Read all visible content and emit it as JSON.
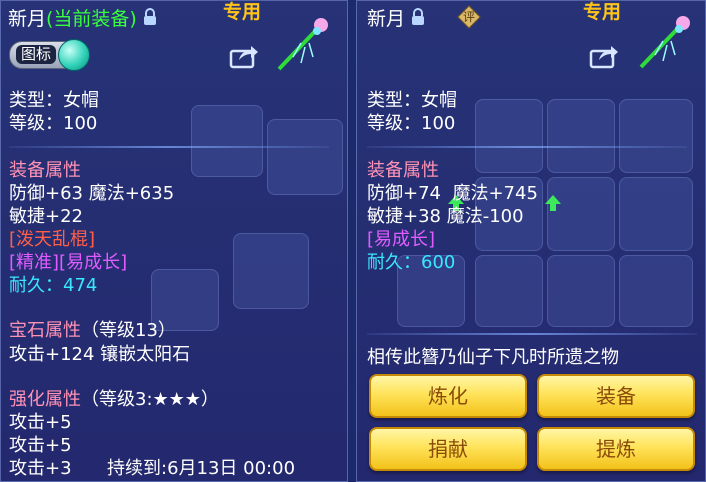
{
  "left": {
    "title_name": "新月",
    "title_equipped": "(当前装备)",
    "exclusive": "专用",
    "toggle_label": "图标",
    "type_line": "类型：女帽",
    "level_line": "等级：100",
    "attr_title": "装备属性",
    "attr_line1": "防御+63 魔法+635",
    "attr_line2": "敏捷+22",
    "special1": "[泼天乱棍]",
    "special2": "[精准][易成长]",
    "durability_label": "耐久：",
    "durability_value": "474",
    "gem_title": "宝石属性",
    "gem_level": "（等级13）",
    "gem_line": "攻击+124 镶嵌太阳石",
    "enhance_title": "强化属性",
    "enhance_level": "（等级3:★★★）",
    "enhance_line1": "攻击+5",
    "enhance_line2": "攻击+5",
    "enhance_line3": "攻击+3",
    "enhance_duration": "持续到:6月13日 00:00"
  },
  "right": {
    "title_name": "新月",
    "appraise_badge": "评",
    "exclusive": "专用",
    "type_line": "类型：女帽",
    "level_line": "等级：100",
    "attr_title": "装备属性",
    "attr_def": "防御+74",
    "attr_magic": "魔法+745",
    "attr_line2": "敏捷+38 魔法-100",
    "special1": "[易成长]",
    "durability_label": "耐久：",
    "durability_value": "600",
    "description": "相传此簪乃仙子下凡时所遗之物",
    "buttons": {
      "refine": "炼化",
      "equip": "装备",
      "donate": "捐献",
      "extract": "提炼"
    }
  },
  "colors": {
    "title_green": "#37ff3c",
    "exclusive_gold": "#ffc41a",
    "section_pink": "#ff92b5",
    "special_red": "#ff5f49",
    "special_purple": "#e05cff",
    "durability_cyan": "#38e8ff",
    "up_arrow_green": "#3ee85c"
  },
  "icons": [
    "lock-icon",
    "share-icon",
    "hairpin-item-icon",
    "toggle-switch",
    "up-arrow-icon"
  ]
}
